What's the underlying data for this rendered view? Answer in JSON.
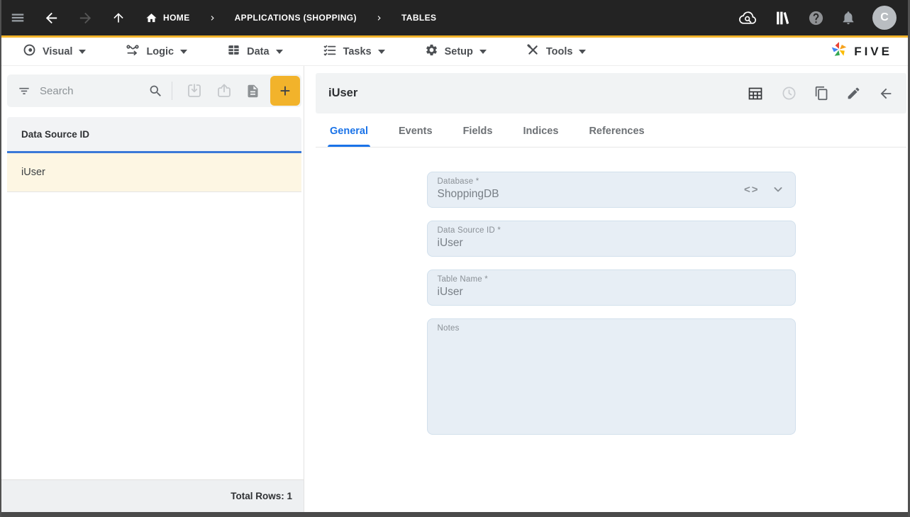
{
  "topbar": {
    "breadcrumbs": [
      {
        "label": "HOME"
      },
      {
        "label": "APPLICATIONS (SHOPPING)"
      },
      {
        "label": "TABLES"
      }
    ],
    "avatar_initial": "C"
  },
  "menubar": {
    "items": [
      {
        "label": "Visual",
        "icon": "visibility-icon"
      },
      {
        "label": "Logic",
        "icon": "logic-flow-icon"
      },
      {
        "label": "Data",
        "icon": "data-grid-icon"
      },
      {
        "label": "Tasks",
        "icon": "task-list-icon"
      },
      {
        "label": "Setup",
        "icon": "gear-icon"
      },
      {
        "label": "Tools",
        "icon": "tools-icon"
      }
    ],
    "brand": "FIVE"
  },
  "left_panel": {
    "search": {
      "placeholder": "Search"
    },
    "add_button_label": "+",
    "column_header": "Data Source ID",
    "rows": [
      {
        "value": "iUser",
        "selected": true
      }
    ],
    "footer": "Total Rows: 1"
  },
  "detail_panel": {
    "title": "iUser",
    "tabs": [
      {
        "label": "General",
        "active": true
      },
      {
        "label": "Events",
        "active": false
      },
      {
        "label": "Fields",
        "active": false
      },
      {
        "label": "Indices",
        "active": false
      },
      {
        "label": "References",
        "active": false
      }
    ],
    "form": {
      "database": {
        "label": "Database *",
        "value": "ShoppingDB",
        "code_glyph": "<>"
      },
      "data_source_id": {
        "label": "Data Source ID *",
        "value": "iUser"
      },
      "table_name": {
        "label": "Table Name *",
        "value": "iUser"
      },
      "notes": {
        "label": "Notes",
        "value": ""
      }
    }
  },
  "colors": {
    "accent_blue": "#1a73e8",
    "brand_yellow": "#F2B32B",
    "selected_row_bg": "#FDF6E3",
    "field_bg": "#E7EEF5",
    "topbar_bg": "#232323"
  },
  "icons": [
    "menu-icon",
    "back-icon",
    "forward-icon",
    "up-icon",
    "home-icon",
    "chevron-right-icon",
    "cloud-search-icon",
    "library-icon",
    "help-icon",
    "bell-icon",
    "avatar",
    "visibility-icon",
    "logic-flow-icon",
    "data-grid-icon",
    "task-list-icon",
    "gear-icon",
    "tools-icon",
    "caret-down-icon",
    "filter-icon",
    "search-icon",
    "import-icon",
    "export-icon",
    "document-icon",
    "plus-button",
    "pinwheel-logo",
    "table-grid-icon",
    "clock-icon",
    "copy-icon",
    "pencil-icon",
    "arrow-left-icon",
    "code-icon",
    "chevron-down-icon"
  ]
}
